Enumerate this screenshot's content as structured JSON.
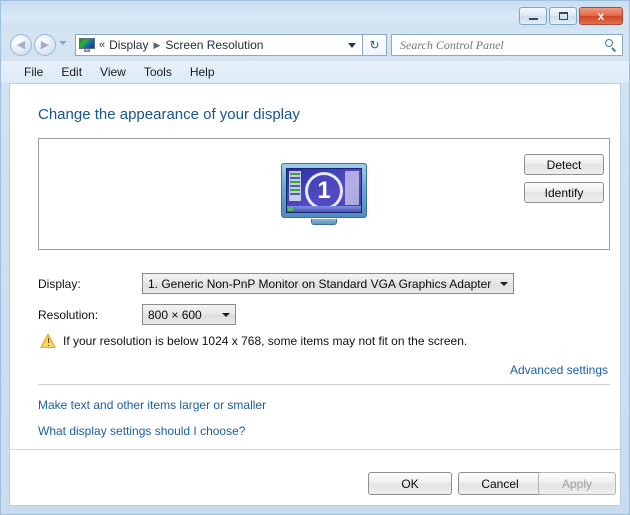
{
  "window": {
    "titlebar": {
      "minimize_label": "Minimize",
      "maximize_label": "Maximize",
      "close_label": "x"
    }
  },
  "nav": {
    "back_arrow": "◀",
    "forward_arrow": "▶",
    "breadcrumb_icon": "display-icon",
    "chevrons": "«",
    "crumb1": "Display",
    "crumb_sep": "▶",
    "crumb2": "Screen Resolution",
    "refresh_glyph": "↻",
    "search_placeholder": "Search Control Panel",
    "search_value": ""
  },
  "menubar": {
    "items": [
      {
        "label": "File"
      },
      {
        "label": "Edit"
      },
      {
        "label": "View"
      },
      {
        "label": "Tools"
      },
      {
        "label": "Help"
      }
    ]
  },
  "main": {
    "heading": "Change the appearance of your display",
    "monitor": {
      "number": "1"
    },
    "detect_label": "Detect",
    "identify_label": "Identify",
    "display_label": "Display:",
    "display_value": "1. Generic Non-PnP Monitor on Standard VGA Graphics Adapter",
    "resolution_label": "Resolution:",
    "resolution_value": "800 × 600",
    "warning_text": "If your resolution is below 1024 x 768, some items may not fit on the screen.",
    "advanced_settings_link": "Advanced settings",
    "link_larger_smaller": "Make text and other items larger or smaller",
    "link_what_settings": "What display settings should I choose?"
  },
  "footer": {
    "ok_label": "OK",
    "cancel_label": "Cancel",
    "apply_label": "Apply"
  },
  "colors": {
    "link": "#1c5fa6",
    "heading": "#17558d",
    "warning": "#e8b023",
    "titlebar": "#d6e5f3",
    "close_button": "#cf4526"
  }
}
